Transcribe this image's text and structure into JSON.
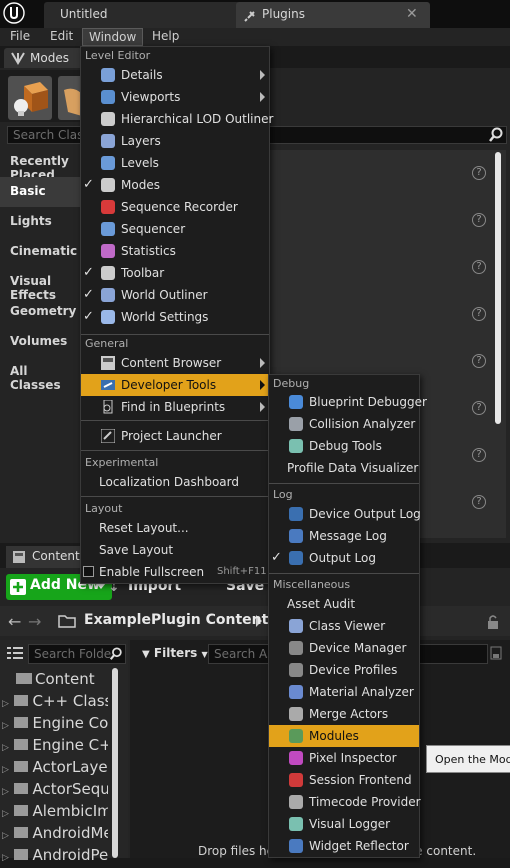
{
  "titlebar": {
    "tab1": "Untitled",
    "tab2": "Plugins"
  },
  "menubar": {
    "file": "File",
    "edit": "Edit",
    "window": "Window",
    "help": "Help"
  },
  "modes": {
    "tab_label": "Modes",
    "search_placeholder": "Search Classes",
    "categories": [
      "Recently Placed",
      "Basic",
      "Lights",
      "Cinematic",
      "Visual Effects",
      "Geometry",
      "Volumes",
      "All Classes"
    ]
  },
  "content_browser": {
    "tab_label": "Content Browser",
    "add_new": "Add New",
    "import": "Import",
    "save": "Save",
    "path": "ExamplePlugin Content",
    "search_folders_placeholder": "Search Folders",
    "filters": "Filters",
    "search_assets_placeholder": "Search Assets",
    "tree": [
      "Content",
      "C++ Classes",
      "Engine Content",
      "Engine C++ Classes",
      "ActorLayerUtilities",
      "ActorSequence",
      "AlembicImporter",
      "AndroidMedia",
      "AndroidPermission"
    ],
    "drop_hint": "Drop files here or right click to create content."
  },
  "window_menu": {
    "sections": {
      "level_editor": "Level Editor",
      "general": "General",
      "experimental": "Experimental",
      "layout": "Layout"
    },
    "level_editor_items": [
      {
        "label": "Details",
        "checked": false,
        "submenu": true
      },
      {
        "label": "Viewports",
        "checked": false,
        "submenu": true
      },
      {
        "label": "Hierarchical LOD Outliner",
        "checked": false,
        "submenu": false
      },
      {
        "label": "Layers",
        "checked": false,
        "submenu": false
      },
      {
        "label": "Levels",
        "checked": false,
        "submenu": false
      },
      {
        "label": "Modes",
        "checked": true,
        "submenu": false
      },
      {
        "label": "Sequence Recorder",
        "checked": false,
        "submenu": false
      },
      {
        "label": "Sequencer",
        "checked": false,
        "submenu": false
      },
      {
        "label": "Statistics",
        "checked": false,
        "submenu": false
      },
      {
        "label": "Toolbar",
        "checked": true,
        "submenu": false
      },
      {
        "label": "World Outliner",
        "checked": true,
        "submenu": false
      },
      {
        "label": "World Settings",
        "checked": true,
        "submenu": false
      }
    ],
    "general_items": [
      "Content Browser",
      "Developer Tools",
      "Find in Blueprints"
    ],
    "project_launcher": "Project Launcher",
    "experimental_item": "Localization Dashboard",
    "layout_items": [
      "Reset Layout...",
      "Save Layout"
    ],
    "fullscreen": "Enable Fullscreen",
    "fullscreen_shortcut": "Shift+F11"
  },
  "dev_tools_menu": {
    "sections": {
      "debug": "Debug",
      "log": "Log",
      "misc": "Miscellaneous"
    },
    "debug_items": [
      "Blueprint Debugger",
      "Collision Analyzer",
      "Debug Tools",
      "Profile Data Visualizer"
    ],
    "log_items": [
      "Device Output Log",
      "Message Log",
      "Output Log"
    ],
    "misc_items": [
      "Asset Audit",
      "Class Viewer",
      "Device Manager",
      "Device Profiles",
      "Material Analyzer",
      "Merge Actors",
      "Modules",
      "Pixel Inspector",
      "Session Frontend",
      "Timecode Provider",
      "Visual Logger",
      "Widget Reflector"
    ]
  },
  "tooltip": "Open the Modules"
}
